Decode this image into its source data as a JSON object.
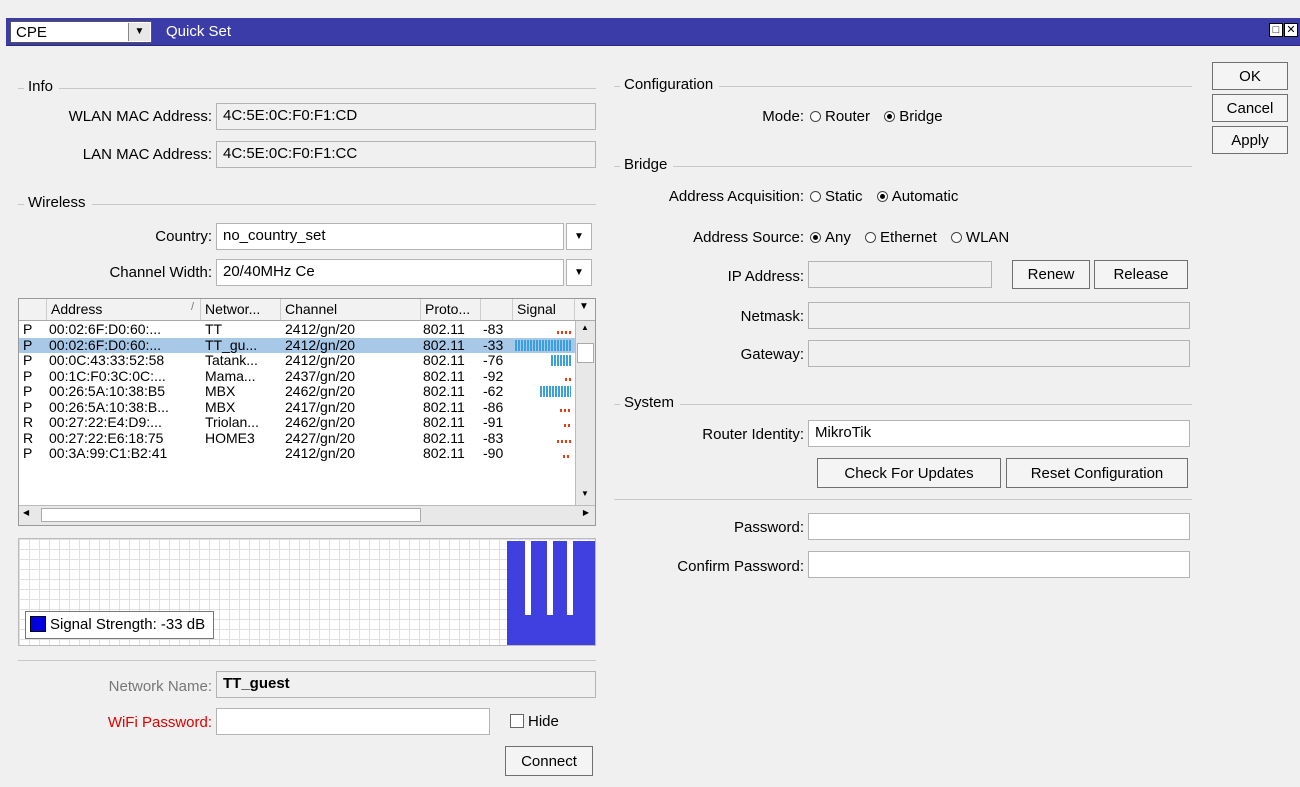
{
  "window": {
    "mode_value": "CPE",
    "title": "Quick Set"
  },
  "buttons": {
    "ok": "OK",
    "cancel": "Cancel",
    "apply": "Apply",
    "renew": "Renew",
    "release": "Release",
    "check_updates": "Check For Updates",
    "reset_config": "Reset Configuration",
    "connect": "Connect"
  },
  "info": {
    "section": "Info",
    "wlan_mac_label": "WLAN MAC Address:",
    "wlan_mac": "4C:5E:0C:F0:F1:CD",
    "lan_mac_label": "LAN MAC Address:",
    "lan_mac": "4C:5E:0C:F0:F1:CC"
  },
  "wireless": {
    "section": "Wireless",
    "country_label": "Country:",
    "country": "no_country_set",
    "channel_width_label": "Channel Width:",
    "channel_width": "20/40MHz Ce",
    "columns": [
      "Address",
      "Networ...",
      "Channel",
      "Proto...",
      "Signal"
    ],
    "rows": [
      {
        "flag": "P",
        "address": "00:02:6F:D0:60:...",
        "network": "TT",
        "channel": "2412/gn/20",
        "proto": "802.11",
        "signal": "-83"
      },
      {
        "flag": "P",
        "address": "00:02:6F:D0:60:...",
        "network": "TT_gu...",
        "channel": "2412/gn/20",
        "proto": "802.11",
        "signal": "-33"
      },
      {
        "flag": "P",
        "address": "00:0C:43:33:52:58",
        "network": "Tatank...",
        "channel": "2412/gn/20",
        "proto": "802.11",
        "signal": "-76"
      },
      {
        "flag": "P",
        "address": "00:1C:F0:3C:0C:...",
        "network": "Mama...",
        "channel": "2437/gn/20",
        "proto": "802.11",
        "signal": "-92"
      },
      {
        "flag": "P",
        "address": "00:26:5A:10:38:B5",
        "network": "MBX",
        "channel": "2462/gn/20",
        "proto": "802.11",
        "signal": "-62"
      },
      {
        "flag": "P",
        "address": "00:26:5A:10:38:B...",
        "network": "MBX",
        "channel": "2417/gn/20",
        "proto": "802.11",
        "signal": "-86"
      },
      {
        "flag": "R",
        "address": "00:27:22:E4:D9:...",
        "network": "Triolan...",
        "channel": "2462/gn/20",
        "proto": "802.11",
        "signal": "-91"
      },
      {
        "flag": "R",
        "address": "00:27:22:E6:18:75",
        "network": "HOME3",
        "channel": "2427/gn/20",
        "proto": "802.11",
        "signal": "-83"
      },
      {
        "flag": "P",
        "address": "00:3A:99:C1:B2:41",
        "network": "",
        "channel": "2412/gn/20",
        "proto": "802.11",
        "signal": "-90"
      }
    ],
    "signal_legend": "Signal Strength:  -33 dB",
    "network_name_label": "Network Name:",
    "network_name": "TT_guest",
    "wifi_password_label": "WiFi Password:",
    "wifi_password": "",
    "hide_label": "Hide"
  },
  "configuration": {
    "section": "Configuration",
    "mode_label": "Mode:",
    "mode_router": "Router",
    "mode_bridge": "Bridge"
  },
  "bridge": {
    "section": "Bridge",
    "acq_label": "Address Acquisition:",
    "acq_static": "Static",
    "acq_automatic": "Automatic",
    "source_label": "Address Source:",
    "source_any": "Any",
    "source_ethernet": "Ethernet",
    "source_wlan": "WLAN",
    "ip_label": "IP Address:",
    "netmask_label": "Netmask:",
    "gateway_label": "Gateway:"
  },
  "system": {
    "section": "System",
    "identity_label": "Router Identity:",
    "identity": "MikroTik",
    "password_label": "Password:",
    "confirm_label": "Confirm Password:"
  },
  "colors": {
    "titlebar": "#3c3ca8",
    "signal_good": "#3aa0e0",
    "signal_bad": "#e04010",
    "graph_fill": "#4040e0",
    "wifi_password_label": "#e00000"
  }
}
